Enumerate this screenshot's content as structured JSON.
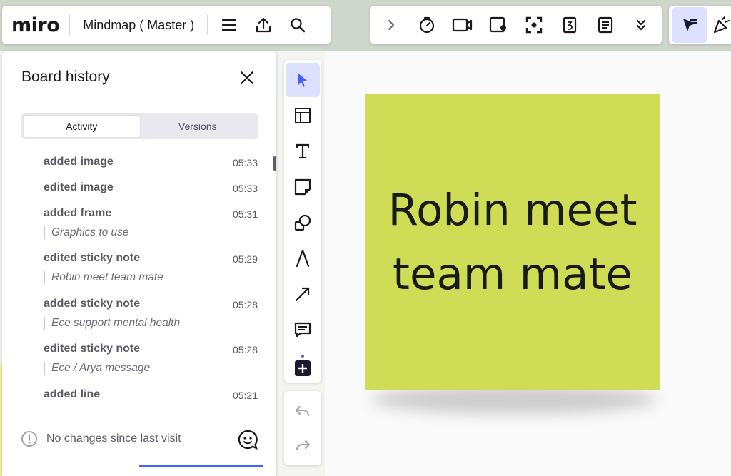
{
  "app": {
    "logo": "miro",
    "board_title": "Mindmap ( Master )"
  },
  "panel": {
    "title": "Board history",
    "tabs": [
      {
        "label": "Activity",
        "active": true
      },
      {
        "label": "Versions",
        "active": false
      }
    ],
    "items": [
      {
        "action": "added image",
        "time": "05:33",
        "detail": ""
      },
      {
        "action": "edited image",
        "time": "05:33",
        "detail": ""
      },
      {
        "action": "added frame",
        "time": "05:31",
        "detail": "Graphics to use"
      },
      {
        "action": "edited sticky note",
        "time": "05:29",
        "detail": "Robin meet team mate"
      },
      {
        "action": "added sticky note",
        "time": "05:28",
        "detail": "Ece support mental health"
      },
      {
        "action": "edited sticky note",
        "time": "05:28",
        "detail": "Ece / Arya message"
      },
      {
        "action": "added line",
        "time": "05:21",
        "detail": ""
      }
    ],
    "footer_text": "No changes since last visit"
  },
  "sticky_note": {
    "text": "Robin meet team mate",
    "color": "#cfdc55"
  },
  "colors": {
    "accent": "#4262ff",
    "active_bg": "#dde0ff"
  },
  "icons": {
    "top_left": [
      "menu-icon",
      "upload-icon",
      "search-icon"
    ],
    "top_center": [
      "chevron-right-icon",
      "timer-icon",
      "video-icon",
      "card-icon",
      "focus-icon",
      "calendar-icon",
      "notes-icon",
      "chevron-double-down-icon"
    ],
    "top_right": [
      "select-cursor-icon",
      "celebrate-icon"
    ],
    "tools": [
      "select-icon",
      "templates-icon",
      "text-icon",
      "sticky-note-icon",
      "shapes-icon",
      "pen-icon",
      "arrow-icon",
      "comment-icon",
      "more-tools-icon"
    ],
    "undo": [
      "undo-icon",
      "redo-icon"
    ]
  }
}
